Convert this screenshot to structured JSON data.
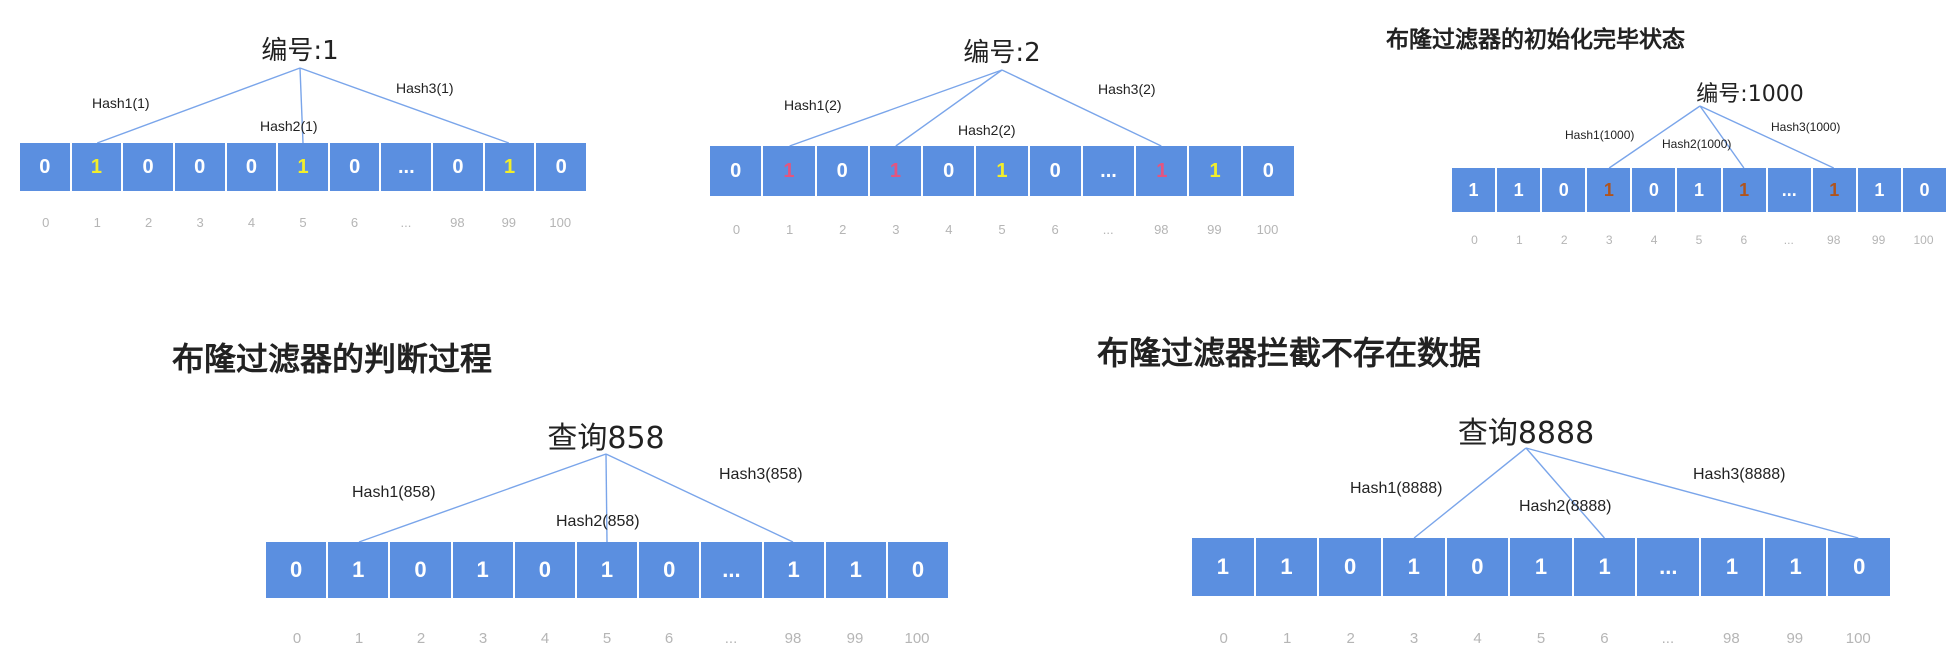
{
  "colors": {
    "cell_bg": "#5b8fe0",
    "bit_white": "#ffffff",
    "bit_yellow": "#f2ee2a",
    "bit_pink": "#e4557f",
    "bit_brown": "#b0541d",
    "index_gray": "#b5b5b5",
    "line_blue": "#7aa5ea"
  },
  "panels": [
    {
      "heading": "",
      "key": "编号:1",
      "hashes": [
        "Hash1(1)",
        "Hash2(1)",
        "Hash3(1)"
      ],
      "cells": [
        "0",
        "1",
        "0",
        "0",
        "0",
        "1",
        "0",
        "...",
        "0",
        "1",
        "0"
      ],
      "cell_colors": [
        "white",
        "yellow",
        "white",
        "white",
        "white",
        "yellow",
        "white",
        "white",
        "white",
        "yellow",
        "white"
      ],
      "indices": [
        "0",
        "1",
        "2",
        "3",
        "4",
        "5",
        "6",
        "...",
        "98",
        "99",
        "100"
      ]
    },
    {
      "heading": "",
      "key": "编号:2",
      "hashes": [
        "Hash1(2)",
        "Hash2(2)",
        "Hash3(2)"
      ],
      "cells": [
        "0",
        "1",
        "0",
        "1",
        "0",
        "1",
        "0",
        "...",
        "1",
        "1",
        "0"
      ],
      "cell_colors": [
        "white",
        "pink",
        "white",
        "pink",
        "white",
        "yellow",
        "white",
        "white",
        "pink",
        "yellow",
        "white"
      ],
      "indices": [
        "0",
        "1",
        "2",
        "3",
        "4",
        "5",
        "6",
        "...",
        "98",
        "99",
        "100"
      ]
    },
    {
      "heading": "布隆过滤器的初始化完毕状态",
      "key": "编号:1000",
      "hashes": [
        "Hash1(1000)",
        "Hash2(1000)",
        "Hash3(1000)"
      ],
      "cells": [
        "1",
        "1",
        "0",
        "1",
        "0",
        "1",
        "1",
        "...",
        "1",
        "1",
        "0"
      ],
      "cell_colors": [
        "white",
        "white",
        "white",
        "brown",
        "white",
        "white",
        "brown",
        "white",
        "brown",
        "white",
        "white"
      ],
      "indices": [
        "0",
        "1",
        "2",
        "3",
        "4",
        "5",
        "6",
        "...",
        "98",
        "99",
        "100"
      ]
    },
    {
      "heading": "布隆过滤器的判断过程",
      "key": "查询858",
      "hashes": [
        "Hash1(858)",
        "Hash2(858)",
        "Hash3(858)"
      ],
      "cells": [
        "0",
        "1",
        "0",
        "1",
        "0",
        "1",
        "0",
        "...",
        "1",
        "1",
        "0"
      ],
      "cell_colors": [
        "white",
        "white",
        "white",
        "white",
        "white",
        "white",
        "white",
        "white",
        "white",
        "white",
        "white"
      ],
      "indices": [
        "0",
        "1",
        "2",
        "3",
        "4",
        "5",
        "6",
        "...",
        "98",
        "99",
        "100"
      ]
    },
    {
      "heading": "布隆过滤器拦截不存在数据",
      "key": "查询8888",
      "hashes": [
        "Hash1(8888)",
        "Hash2(8888)",
        "Hash3(8888)"
      ],
      "cells": [
        "1",
        "1",
        "0",
        "1",
        "0",
        "1",
        "1",
        "...",
        "1",
        "1",
        "0"
      ],
      "cell_colors": [
        "white",
        "white",
        "white",
        "white",
        "white",
        "white",
        "white",
        "white",
        "white",
        "white",
        "white"
      ],
      "indices": [
        "0",
        "1",
        "2",
        "3",
        "4",
        "5",
        "6",
        "...",
        "98",
        "99",
        "100"
      ]
    }
  ]
}
